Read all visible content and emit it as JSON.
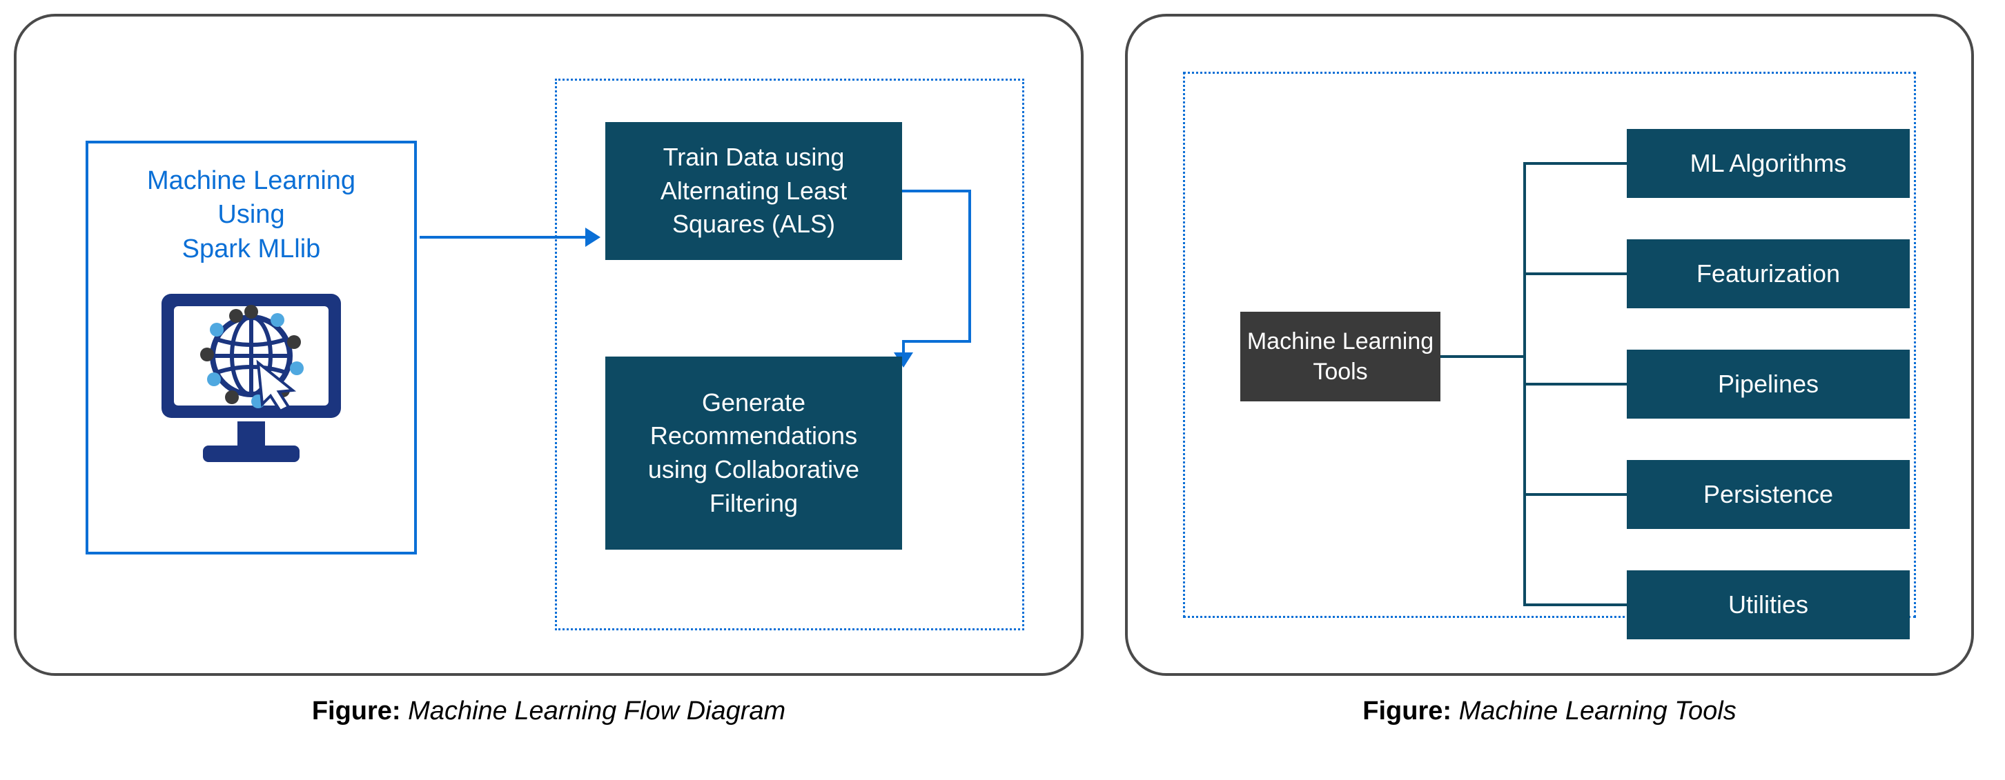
{
  "left": {
    "caption_label": "Figure:",
    "caption_text": "Machine Learning Flow Diagram",
    "ml_title_l1": "Machine Learning",
    "ml_title_l2": "Using",
    "ml_title_l3": "Spark MLlib",
    "step1": "Train Data using Alternating Least Squares (ALS)",
    "step2": "Generate Recommendations using Collaborative Filtering"
  },
  "right": {
    "caption_label": "Figure:",
    "caption_text": "Machine Learning Tools",
    "hub": "Machine Learning Tools",
    "tools": [
      "ML Algorithms",
      "Featurization",
      "Pipelines",
      "Persistence",
      "Utilities"
    ]
  }
}
